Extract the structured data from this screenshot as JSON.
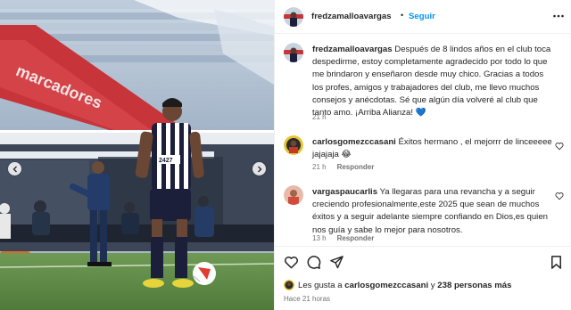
{
  "colors": {
    "accent": "#0095f6",
    "text": "#262626",
    "muted": "#737373",
    "heart_blue": "#3897f0"
  },
  "photo": {
    "description_icon": "photo",
    "stadium_text_1": "marcadores",
    "stadium_text_2": "2427",
    "shirt_number": "2427",
    "prev_icon": "chevron-left-icon",
    "next_icon": "chevron-right-icon"
  },
  "header": {
    "username": "fredzamalloavargas",
    "separator": "•",
    "follow_label": "Seguir",
    "more_icon": "more-horizontal-icon"
  },
  "caption": {
    "username": "fredzamalloavargas",
    "text": "Después de 8 lindos años en el club toca despedirme, estoy completamente agradecido por todo lo que me brindaron y enseñaron desde muy chico. Gracias a todos los profes, amigos y trabajadores del club, me llevo muchos consejos y anécdotas. Sé que algún día volveré al club que tanto amo. ¡Arriba Alianza! 💙",
    "time": "21 h"
  },
  "comments": [
    {
      "username": "carlosgomezccasani",
      "text": "Éxitos hermano , el mejorrr de linceeeee jajajaja 😂",
      "time": "21 h",
      "reply_label": "Responder"
    },
    {
      "username": "vargaspaucarlis",
      "text": "Ya llegaras para una revancha y a seguir creciendo profesionalmente,este 2025 que sean de muchos éxitos y a seguir adelante siempre confiando en Dios,es quien nos guía y sabe lo mejor para nosotros.",
      "time": "13 h",
      "reply_label": "Responder"
    }
  ],
  "actions": {
    "like_icon": "heart-icon",
    "comment_icon": "comment-icon",
    "share_icon": "send-icon",
    "save_icon": "bookmark-icon"
  },
  "likes": {
    "prefix": "Les gusta a ",
    "user": "carlosgomezccasani",
    "middle": " y ",
    "count_text": "238 personas más"
  },
  "posted": "Hace 21 horas"
}
